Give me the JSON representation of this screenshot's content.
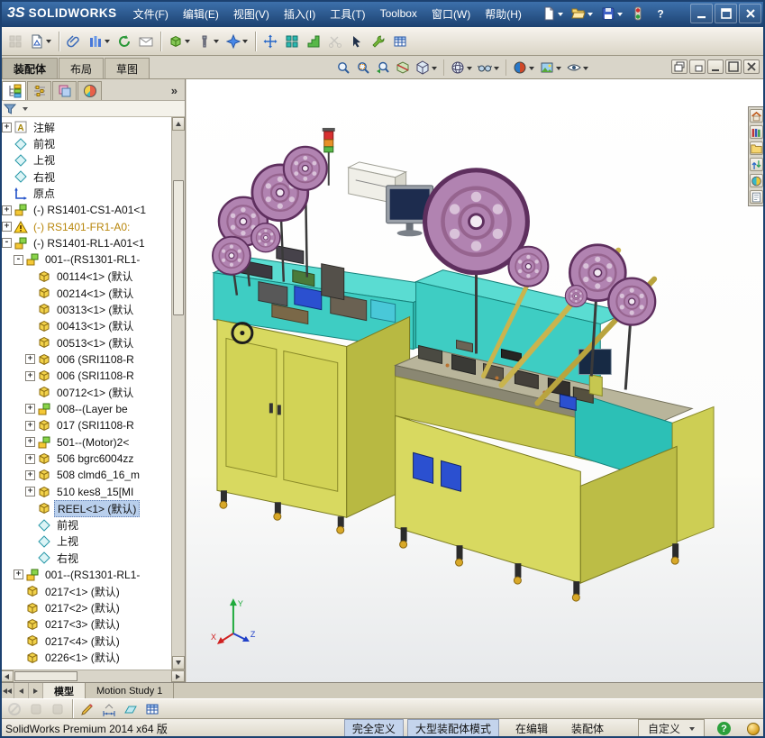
{
  "titlebar": {
    "logo_mark": "3S",
    "logo_text": "SOLIDWORKS",
    "menus": [
      "文件(F)",
      "编辑(E)",
      "视图(V)",
      "插入(I)",
      "工具(T)",
      "Toolbox",
      "窗口(W)",
      "帮助(H)"
    ],
    "quick_icons": [
      {
        "name": "new-document-button",
        "icon": "new-doc",
        "dropdown": true
      },
      {
        "name": "open-document-button",
        "icon": "open-doc",
        "dropdown": true
      },
      {
        "name": "save-document-button",
        "icon": "save-doc",
        "dropdown": true
      },
      {
        "name": "connection-status-icon",
        "icon": "status-toggle",
        "dropdown": false
      },
      {
        "name": "help-button",
        "icon": "help-q",
        "dropdown": false
      }
    ],
    "window_controls": [
      {
        "name": "minimize-button",
        "icon": "win-min"
      },
      {
        "name": "maximize-button",
        "icon": "win-max"
      },
      {
        "name": "close-button",
        "icon": "win-close"
      }
    ]
  },
  "main_toolbar": {
    "icons": [
      {
        "name": "print-button",
        "icon": "gray-grid",
        "disabled": true
      },
      {
        "name": "make-drawing-button",
        "icon": "drawing-doc",
        "dropdown": true
      },
      {
        "sep": true
      },
      {
        "name": "mate-button",
        "icon": "paperclip"
      },
      {
        "name": "component-pattern-button",
        "icon": "bars-blue",
        "dropdown": true
      },
      {
        "name": "rebuild-button",
        "icon": "refresh-green"
      },
      {
        "name": "pack-and-go-button",
        "icon": "mail"
      },
      {
        "sep": true
      },
      {
        "name": "insert-component-button",
        "icon": "cube-green",
        "dropdown": true
      },
      {
        "name": "smart-fasteners-button",
        "icon": "fastener",
        "dropdown": true
      },
      {
        "name": "new-motion-study-button",
        "icon": "star-blue",
        "dropdown": true
      },
      {
        "sep": true
      },
      {
        "name": "move-component-button",
        "icon": "move-arrows"
      },
      {
        "name": "linear-pattern-button",
        "icon": "grid-teal"
      },
      {
        "name": "exploded-view-button",
        "icon": "stairs-green"
      },
      {
        "name": "trim-button",
        "icon": "scissors-gray",
        "disabled": true
      },
      {
        "name": "select-button",
        "icon": "lasso"
      },
      {
        "name": "assembly-tools-button",
        "icon": "wrench-green"
      },
      {
        "name": "design-table-button",
        "icon": "table-grid"
      }
    ]
  },
  "ribbon_tabs": [
    {
      "label": "装配体",
      "active": true
    },
    {
      "label": "布局",
      "active": false
    },
    {
      "label": "草图",
      "active": false
    }
  ],
  "left_panel": {
    "overflow_label": "»",
    "tabs": [
      {
        "name": "featuremanager-tab",
        "icon": "tab-tree",
        "active": true
      },
      {
        "name": "propertymanager-tab",
        "icon": "tab-props",
        "active": false
      },
      {
        "name": "configurationmanager-tab",
        "icon": "tab-config",
        "active": false
      },
      {
        "name": "appearances-tab",
        "icon": "tab-ball",
        "active": false
      }
    ],
    "tree": {
      "items": [
        {
          "lv": 1,
          "exp": "+",
          "icon": "annotations",
          "label": "注解"
        },
        {
          "lv": 1,
          "exp": "",
          "icon": "plane",
          "label": "前视"
        },
        {
          "lv": 1,
          "exp": "",
          "icon": "plane",
          "label": "上视"
        },
        {
          "lv": 1,
          "exp": "",
          "icon": "plane",
          "label": "右视"
        },
        {
          "lv": 1,
          "exp": "",
          "icon": "origin",
          "label": "原点"
        },
        {
          "lv": 1,
          "exp": "+",
          "icon": "assembly",
          "label": "(-) RS1401-CS1-A01<1"
        },
        {
          "lv": 1,
          "exp": "+",
          "icon": "warning",
          "label": "(-) RS1401-FR1-A0:",
          "state": "warning"
        },
        {
          "lv": 1,
          "exp": "-",
          "icon": "assembly",
          "label": "(-) RS1401-RL1-A01<1"
        },
        {
          "lv": 2,
          "exp": "-",
          "icon": "assembly",
          "label": "001--(RS1301-RL1-"
        },
        {
          "lv": 3,
          "exp": "",
          "icon": "part",
          "label": "00114<1> (默认"
        },
        {
          "lv": 3,
          "exp": "",
          "icon": "part",
          "label": "00214<1> (默认"
        },
        {
          "lv": 3,
          "exp": "",
          "icon": "part",
          "label": "00313<1> (默认"
        },
        {
          "lv": 3,
          "exp": "",
          "icon": "part",
          "label": "00413<1> (默认"
        },
        {
          "lv": 3,
          "exp": "",
          "icon": "part",
          "label": "00513<1> (默认"
        },
        {
          "lv": 3,
          "exp": "+",
          "icon": "part",
          "label": "006 (SRI1108-R"
        },
        {
          "lv": 3,
          "exp": "+",
          "icon": "part",
          "label": "006 (SRI1108-R"
        },
        {
          "lv": 3,
          "exp": "",
          "icon": "part",
          "label": "00712<1> (默认"
        },
        {
          "lv": 3,
          "exp": "+",
          "icon": "assembly",
          "label": "008--(Layer be"
        },
        {
          "lv": 3,
          "exp": "+",
          "icon": "part",
          "label": "017 (SRI1108-R"
        },
        {
          "lv": 3,
          "exp": "+",
          "icon": "assembly",
          "label": "501--(Motor)2<"
        },
        {
          "lv": 3,
          "exp": "+",
          "icon": "part",
          "label": "506 bgrc6004zz"
        },
        {
          "lv": 3,
          "exp": "+",
          "icon": "part",
          "label": "508 clmd6_16_m"
        },
        {
          "lv": 3,
          "exp": "+",
          "icon": "part",
          "label": "510 kes8_15[MI"
        },
        {
          "lv": 3,
          "exp": "",
          "icon": "part",
          "label": "REEL<1> (默认)",
          "state": "selected"
        },
        {
          "lv": 3,
          "exp": "",
          "icon": "plane",
          "label": "前视"
        },
        {
          "lv": 3,
          "exp": "",
          "icon": "plane",
          "label": "上视"
        },
        {
          "lv": 3,
          "exp": "",
          "icon": "plane",
          "label": "右视"
        },
        {
          "lv": 2,
          "exp": "+",
          "icon": "assembly",
          "label": "001--(RS1301-RL1-"
        },
        {
          "lv": 2,
          "exp": "",
          "icon": "part",
          "label": "0217<1> (默认)"
        },
        {
          "lv": 2,
          "exp": "",
          "icon": "part",
          "label": "0217<2> (默认)"
        },
        {
          "lv": 2,
          "exp": "",
          "icon": "part",
          "label": "0217<3> (默认)"
        },
        {
          "lv": 2,
          "exp": "",
          "icon": "part",
          "label": "0217<4> (默认)"
        },
        {
          "lv": 2,
          "exp": "",
          "icon": "part",
          "label": "0226<1> (默认)"
        }
      ]
    }
  },
  "viewport": {
    "headsup": [
      {
        "name": "zoom-to-fit-button",
        "icon": "zoom-fit"
      },
      {
        "name": "zoom-to-area-button",
        "icon": "zoom-area"
      },
      {
        "name": "previous-view-button",
        "icon": "zoom-prev"
      },
      {
        "name": "section-view-button",
        "icon": "section"
      },
      {
        "name": "view-orientation-button",
        "icon": "cube-view",
        "dropdown": true
      },
      {
        "sep": true
      },
      {
        "name": "display-style-button",
        "icon": "display-style",
        "dropdown": true
      },
      {
        "name": "hide-show-items-button",
        "icon": "glasses",
        "dropdown": true
      },
      {
        "sep": true
      },
      {
        "name": "edit-appearance-button",
        "icon": "appearance-ball",
        "dropdown": true
      },
      {
        "name": "apply-scene-button",
        "icon": "scene",
        "dropdown": true
      },
      {
        "name": "view-settings-button",
        "icon": "eye",
        "dropdown": true
      }
    ],
    "doc_controls": [
      {
        "name": "doc-restore-button",
        "icon": "doc-restore"
      },
      {
        "name": "doc-float-button",
        "icon": "doc-win"
      },
      {
        "name": "doc-minimize-button",
        "icon": "doc-min"
      },
      {
        "name": "doc-maximize-button",
        "icon": "doc-max"
      },
      {
        "name": "doc-close-button",
        "icon": "doc-close"
      }
    ],
    "taskpane": [
      {
        "name": "taskpane-resources-tab",
        "icon": "home"
      },
      {
        "name": "taskpane-design-library-tab",
        "icon": "books"
      },
      {
        "name": "taskpane-file-explorer-tab",
        "icon": "folder-sm"
      },
      {
        "name": "taskpane-view-palette-tab",
        "icon": "updown"
      },
      {
        "name": "taskpane-appearances-tab",
        "icon": "sphere"
      },
      {
        "name": "taskpane-custom-properties-tab",
        "icon": "notepad"
      }
    ],
    "triad": {
      "x": "X",
      "y": "Y",
      "z": "Z"
    }
  },
  "bottom_bar": {
    "tabs": [
      {
        "label": "模型",
        "active": true
      },
      {
        "label": "Motion Study 1",
        "active": false
      }
    ]
  },
  "bottom_toolbar": {
    "icons": [
      {
        "name": "bottom-tool-disabled-1",
        "icon": "slash-gray",
        "disabled": true
      },
      {
        "name": "bottom-tool-disabled-2",
        "icon": "gray-blob",
        "disabled": true
      },
      {
        "name": "bottom-tool-disabled-3",
        "icon": "gray-blob",
        "disabled": true
      },
      {
        "sep": true
      },
      {
        "name": "sketch-button",
        "icon": "sketch-pencil"
      },
      {
        "name": "smart-dimension-button",
        "icon": "dimension"
      },
      {
        "name": "reference-plane-button",
        "icon": "plane3d"
      },
      {
        "name": "design-table-bottom-button",
        "icon": "table-grid"
      }
    ]
  },
  "statusbar": {
    "app_name": "SolidWorks Premium 2014 x64 版",
    "segments": [
      {
        "label": "完全定义",
        "style": "info"
      },
      {
        "label": "大型装配体模式",
        "style": "info"
      },
      {
        "label": "在编辑",
        "style": "plain"
      },
      {
        "label": "装配体",
        "style": "plain"
      }
    ],
    "custom_label": "自定义"
  }
}
